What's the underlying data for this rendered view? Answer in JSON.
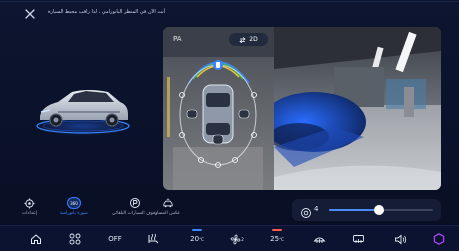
{
  "header": {
    "message": "أنت الآن في المنظر البانورامي ، لذا راقب محيط السيارة"
  },
  "camera": {
    "gear_label": "PA",
    "view_toggle_label": "2D",
    "view_toggle_icon": "swap-arrows-icon"
  },
  "quick_actions": [
    {
      "label": "إعدادات",
      "icon": "gear-icon"
    },
    {
      "label": "صورة بانورامية",
      "icon": "panorama-360-icon",
      "icon_text": "360",
      "active": true
    },
    {
      "label": "وقوف السيارات التلقائي",
      "icon": "auto-park-icon"
    },
    {
      "label": "عكس المسار",
      "icon": "track-reverse-icon"
    }
  ],
  "volume_slider": {
    "icon": "camera-speaker-icon",
    "value": "4",
    "level": 0.48
  },
  "dock": {
    "home_icon": "home-icon",
    "apps_icon": "apps-grid-icon",
    "off_label": "OFF",
    "seat_heat_icon": "seat-heat-icon",
    "left_temp": "20",
    "left_temp_unit": "°C",
    "fan_icon": "fan-icon",
    "fan_level": "2",
    "right_temp": "25",
    "right_temp_unit": "°C",
    "front_defrost_icon": "front-defrost-icon",
    "rear_defrost_icon": "rear-defrost-icon",
    "volume_icon": "volume-icon",
    "brand_icon": "hexagon-brand-icon"
  },
  "colors": {
    "accent": "#3a86ff",
    "left_temp_bar": "#3a86ff",
    "right_temp_bar": "#ff5a4a",
    "brand": "#b347ff"
  }
}
